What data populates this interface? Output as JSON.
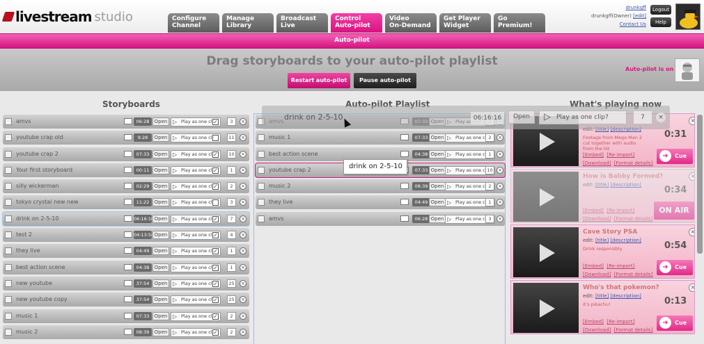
{
  "header": {
    "logo_name": "livestream",
    "logo_suffix": "studio",
    "tabs": [
      {
        "label": "Configure\nChannel"
      },
      {
        "label": "Manage\nLibrary"
      },
      {
        "label": "Broadcast\nLive"
      },
      {
        "label": "Control\nAuto-pilot"
      },
      {
        "label": "Video\nOn-Demand"
      },
      {
        "label": "Get Player\nWidget"
      },
      {
        "label": "Go\nPremium!"
      }
    ],
    "user": {
      "name": "drunkgff",
      "line2": "drunkgff(Owner)",
      "edit": "[edit]",
      "contact": "Contact Us"
    },
    "logout": "Logout",
    "help": "Help"
  },
  "pink_bar": {
    "label": "Auto-pilot"
  },
  "autopilot": {
    "heading": "Drag storyboards to your auto-pilot playlist",
    "restart": "Restart auto-pilot",
    "pause": "Pause auto-pilot",
    "status": "Auto-pilot is on"
  },
  "columns": {
    "storyboards": "Storyboards",
    "playlist": "Auto-pilot Playlist",
    "now_playing": "What's playing now"
  },
  "row_labels": {
    "open": "Open",
    "play": "Play as one clip?",
    "x": "×"
  },
  "storyboards": [
    {
      "name": "amvs",
      "dur": "06:28",
      "count": "3",
      "checked": true
    },
    {
      "name": "youtube crap old",
      "dur": "9:28",
      "count": "11",
      "checked": false
    },
    {
      "name": "youtube crap 2",
      "dur": "07:33",
      "count": "10",
      "checked": true
    },
    {
      "name": "Your first storyboard",
      "dur": "00:11",
      "count": "1",
      "checked": true
    },
    {
      "name": "silly wickerman",
      "dur": "02:29",
      "count": "2",
      "checked": true
    },
    {
      "name": "tokyo crystal new new",
      "dur": "11:22",
      "count": "3",
      "checked": false
    },
    {
      "name": "drink on 2-5-10",
      "dur": "06:16:16",
      "count": "7",
      "checked": true
    },
    {
      "name": "test 2",
      "dur": "04:13:54",
      "count": "4",
      "checked": true
    },
    {
      "name": "they live",
      "dur": "04:49",
      "count": "1",
      "checked": true
    },
    {
      "name": "best action scene",
      "dur": "04:38",
      "count": "1",
      "checked": true
    },
    {
      "name": "new youtube",
      "dur": "37:54",
      "count": "25",
      "checked": true
    },
    {
      "name": "new youtube copy",
      "dur": "37:54",
      "count": "25",
      "checked": true
    },
    {
      "name": "music 1",
      "dur": "07:33",
      "count": "2",
      "checked": true
    },
    {
      "name": "music 2",
      "dur": "08:39",
      "count": "2",
      "checked": true
    }
  ],
  "playlist": [
    {
      "name": "amvs",
      "dur": "07:33",
      "count": "2",
      "checked": true
    },
    {
      "name": "music 1",
      "dur": "07:33",
      "count": "2",
      "checked": true
    },
    {
      "name": "best action scene",
      "dur": "04:38",
      "count": "1",
      "checked": true
    },
    {
      "name": "youtube crap 2",
      "dur": "07:33",
      "count": "10",
      "checked": true
    },
    {
      "name": "music 2",
      "dur": "08:39",
      "count": "2",
      "checked": true
    },
    {
      "name": "they live",
      "dur": "04:49",
      "count": "1",
      "checked": true
    },
    {
      "name": "amvs",
      "dur": "06:28",
      "count": "3",
      "checked": true
    }
  ],
  "drag_ghost": {
    "name": "drink on 2-5-10",
    "dur": "06:16:16",
    "open": "Open",
    "play": "Play as one clip?",
    "count": "7",
    "x": "×"
  },
  "tooltip": "drink on 2-5-10",
  "now_playing": [
    {
      "title": "",
      "edit_prefix": "edit:",
      "title_link": "[title]",
      "desc_link": "[description]",
      "desc": "Footage from Mega Man 2 cut together with audio from the hit",
      "dur": "0:31",
      "embed": "[Embed]",
      "reimport": "[Re-import]",
      "download": "[Download]",
      "format": "[Format details]",
      "action": "Cue",
      "faded": false,
      "onair": false
    },
    {
      "title": "How is Babby Formed?",
      "edit_prefix": "edit:",
      "title_link": "[title]",
      "desc_link": "[description]",
      "desc": "",
      "dur": "0:34",
      "embed": "[Embed]",
      "reimport": "[Re-import]",
      "download": "[Download]",
      "format": "[Format details]",
      "action": "ON AIR",
      "faded": true,
      "onair": true
    },
    {
      "title": "Cave Story PSA",
      "edit_prefix": "edit:",
      "title_link": "[title]",
      "desc_link": "[description]",
      "desc": "Drink responsibly",
      "dur": "0:54",
      "embed": "[Embed]",
      "reimport": "[Re-import]",
      "download": "[Download]",
      "format": "[Format details]",
      "action": "Cue",
      "faded": false,
      "onair": false
    },
    {
      "title": "Who's that pokemon?",
      "edit_prefix": "edit:",
      "title_link": "[title]",
      "desc_link": "[description]",
      "desc": "it's pikachu!",
      "dur": "0:13",
      "embed": "[Embed]",
      "reimport": "[Re-import]",
      "download": "[Download]",
      "format": "[Format details]",
      "action": "Cue",
      "faded": false,
      "onair": false
    }
  ]
}
